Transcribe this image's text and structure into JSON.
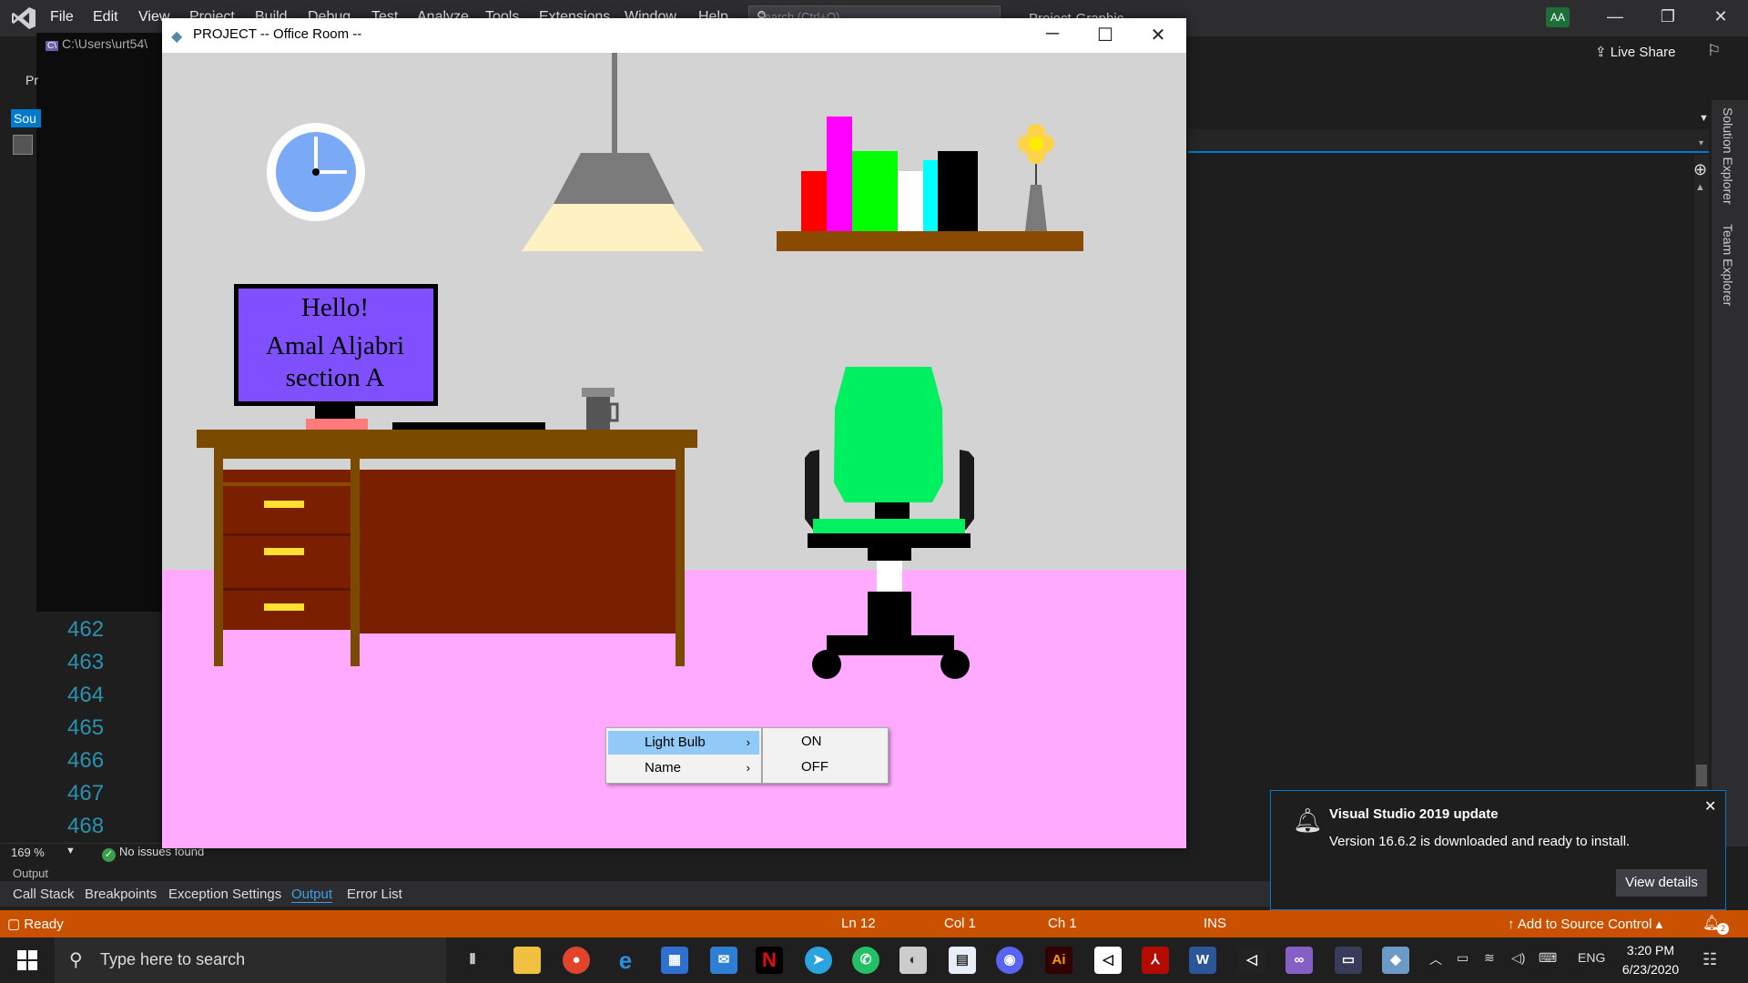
{
  "vs": {
    "menu": [
      "File",
      "Edit",
      "View",
      "Project",
      "Build",
      "Debug",
      "Test",
      "Analyze",
      "Tools",
      "Extensions",
      "Window",
      "Help"
    ],
    "search_placeholder": "Search (Ctrl+Q)",
    "project_label": "Project-Graphic",
    "avatar_initials": "AA",
    "live_share": "Live Share",
    "console_path": "C:\\Users\\urt54\\",
    "pr_label": "Pr",
    "sou_tab": "Sou",
    "line_numbers": [
      "462",
      "463",
      "464",
      "465",
      "466",
      "467",
      "468"
    ],
    "zoom": "169 %",
    "issues": "No issues found",
    "output_label": "Output",
    "bottom_tabs": [
      "Call Stack",
      "Breakpoints",
      "Exception Settings",
      "Output",
      "Error List"
    ],
    "active_bottom_tab": "Output",
    "side_tabs": [
      "Solution Explorer",
      "Team Explorer"
    ],
    "status": {
      "ready": "Ready",
      "ln": "Ln 12",
      "col": "Col 1",
      "ch": "Ch 1",
      "ins": "INS",
      "source_control": "Add to Source Control",
      "notif_count": "2"
    },
    "notification": {
      "title": "Visual Studio 2019 update",
      "body": "Version 16.6.2 is downloaded and ready to install.",
      "button": "View details"
    },
    "accent": "#007acc",
    "status_color": "#ca5100"
  },
  "glut": {
    "title": "PROJECT -- Office Room --",
    "monitor_lines": [
      "Hello!",
      "Amal Aljabri",
      "section A"
    ],
    "context_menu": {
      "items": [
        "Light Bulb",
        "Name"
      ],
      "highlighted": "Light Bulb",
      "submenu": [
        "ON",
        "OFF"
      ]
    },
    "colors": {
      "wall": "#d3d3d3",
      "floor": "#ffaaff",
      "monitor": "#8050ff",
      "chair": "#00f060",
      "desk": "#7a4a00",
      "desk_panel": "#7a2000"
    }
  },
  "taskbar": {
    "search_placeholder": "Type here to search",
    "language": "ENG",
    "time": "3:20 PM",
    "date": "6/23/2020",
    "icons": [
      "task-view",
      "file-explorer",
      "chrome",
      "edge",
      "store",
      "mail",
      "netflix",
      "telegram",
      "whatsapp",
      "paint",
      "scanner",
      "discord",
      "illustrator",
      "unity",
      "acrobat",
      "word",
      "unity-hub",
      "visual-studio",
      "console",
      "glut-app"
    ]
  }
}
